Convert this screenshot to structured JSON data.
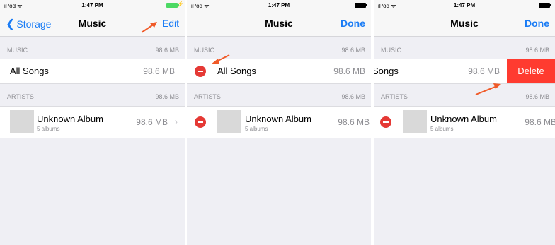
{
  "status": {
    "device": "iPod ᯤ",
    "time": "1:47 PM"
  },
  "panel1": {
    "back_label": "Storage",
    "title": "Music",
    "right_button": "Edit",
    "section1": {
      "label": "MUSIC",
      "size": "98.6 MB"
    },
    "row1": {
      "title": "All Songs",
      "size": "98.6 MB"
    },
    "section2": {
      "label": "ARTISTS",
      "size": "98.6 MB"
    },
    "row2": {
      "title": "Unknown Album",
      "subtitle": "5 albums",
      "size": "98.6 MB"
    }
  },
  "panel2": {
    "title": "Music",
    "right_button": "Done",
    "section1": {
      "label": "MUSIC",
      "size": "98.6 MB"
    },
    "row1": {
      "title": "All Songs",
      "size": "98.6 MB"
    },
    "section2": {
      "label": "ARTISTS",
      "size": "98.6 MB"
    },
    "row2": {
      "title": "Unknown Album",
      "subtitle": "5 albums",
      "size": "98.6 MB"
    }
  },
  "panel3": {
    "title": "Music",
    "right_button": "Done",
    "section1": {
      "label": "MUSIC",
      "size": "98.6 MB"
    },
    "row1": {
      "title": "Songs",
      "size": "98.6 MB",
      "delete_label": "Delete"
    },
    "section2": {
      "label": "ARTISTS",
      "size": "98.6 MB"
    },
    "row2": {
      "title": "Unknown Album",
      "subtitle": "5 albums",
      "size": "98.6 MB"
    }
  },
  "colors": {
    "accent": "#1a7cf5",
    "delete": "#ff3b30",
    "annotation_arrow": "#f05a28"
  }
}
